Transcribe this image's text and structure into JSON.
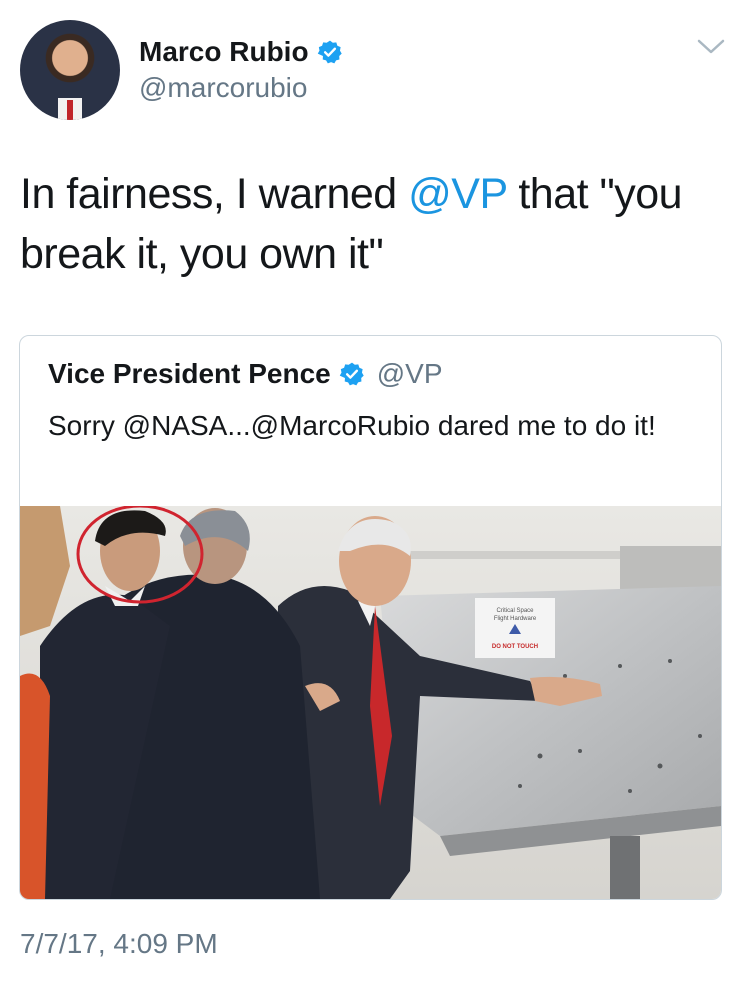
{
  "author": {
    "name": "Marco Rubio",
    "handle": "@marcorubio",
    "verified": true,
    "avatar_icon": "profile-photo"
  },
  "tweet": {
    "text_before": "In fairness, I warned ",
    "mention": "@VP",
    "text_after": " that \"you break it, you own it\"",
    "timestamp": "7/7/17, 4:09 PM"
  },
  "quoted": {
    "name": "Vice President Pence",
    "handle": "@VP",
    "verified": true,
    "text": "Sorry @NASA...@MarcoRubio dared me to do it!",
    "image_sign_text": "DO NOT TOUCH"
  },
  "colors": {
    "text": "#14171a",
    "secondary": "#657786",
    "link": "#1b95e0",
    "verified": "#1da1f2",
    "border": "#ccd6dd",
    "highlight_circle": "#d0242f"
  }
}
